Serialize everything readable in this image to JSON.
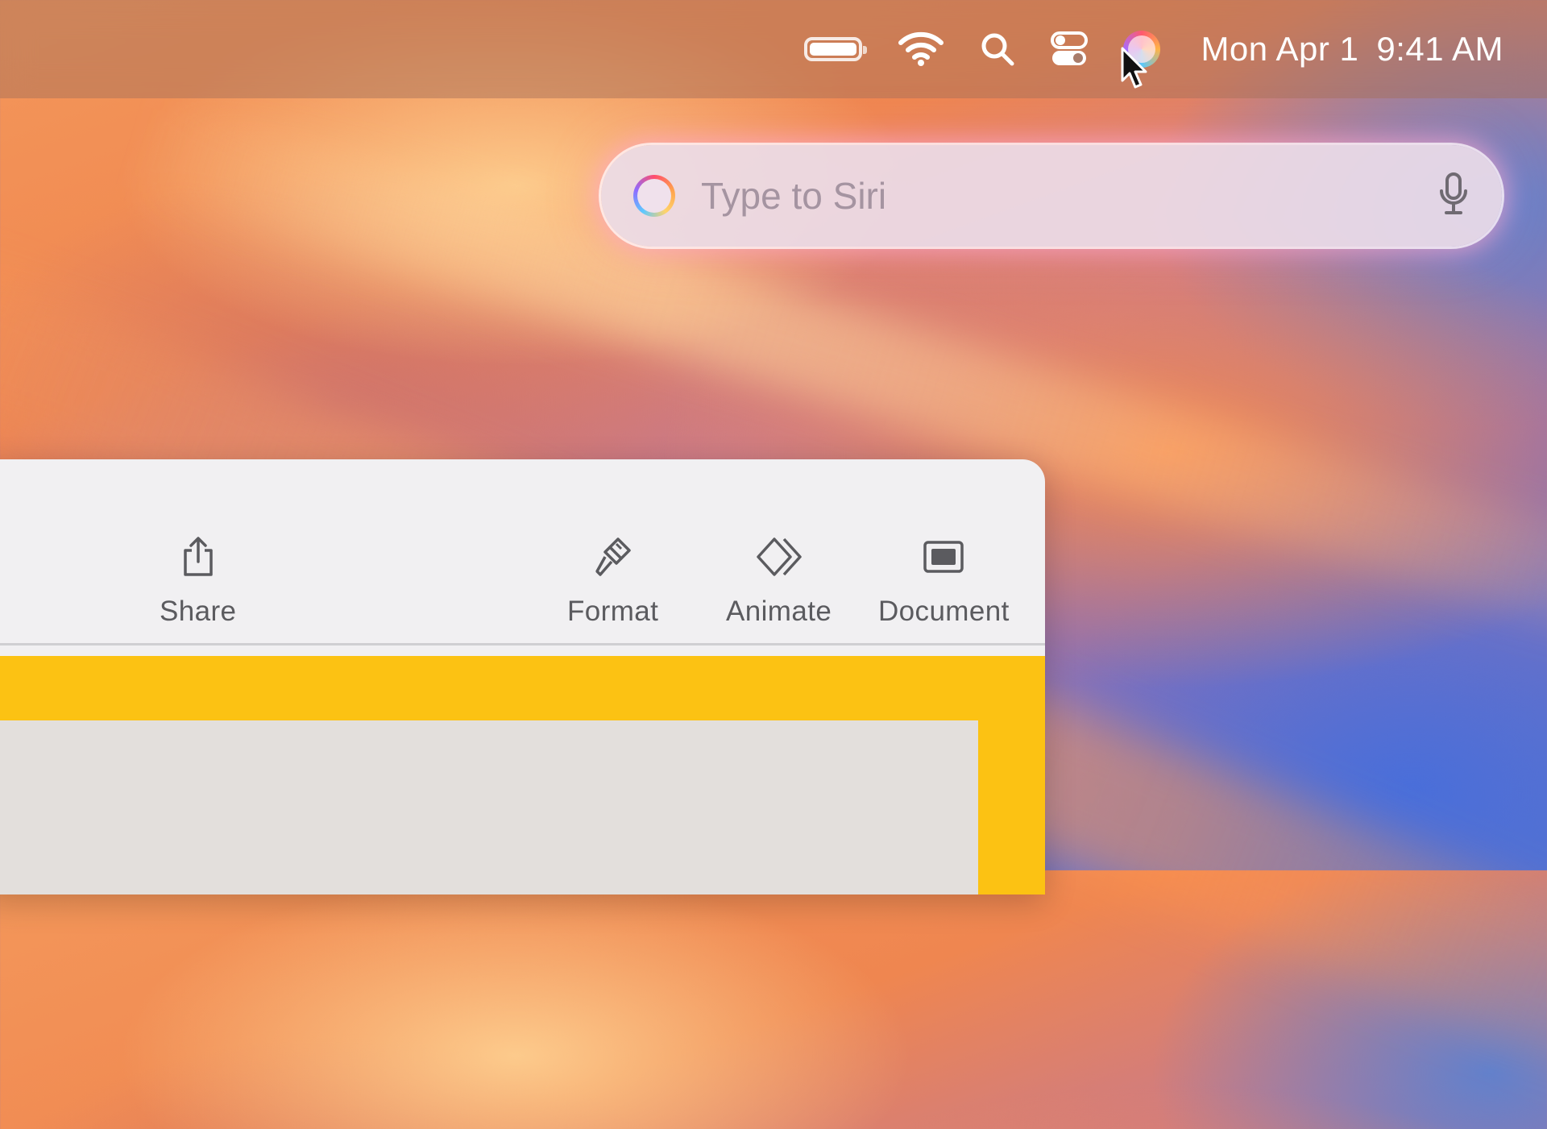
{
  "menubar": {
    "date": "Mon Apr 1",
    "time": "9:41 AM",
    "icons": [
      "battery-icon",
      "wifi-icon",
      "search-icon",
      "control-center-icon",
      "siri-icon"
    ]
  },
  "siri": {
    "placeholder": "Type to Siri",
    "icons": [
      "siri-icon",
      "microphone-icon"
    ]
  },
  "toolbar": {
    "share_label": "Share",
    "format_label": "Format",
    "animate_label": "Animate",
    "document_label": "Document"
  },
  "colors": {
    "slide_accent": "#fcc213",
    "toolbar_bg": "#f1f0f2",
    "siri_glow": "#ffaad2"
  }
}
